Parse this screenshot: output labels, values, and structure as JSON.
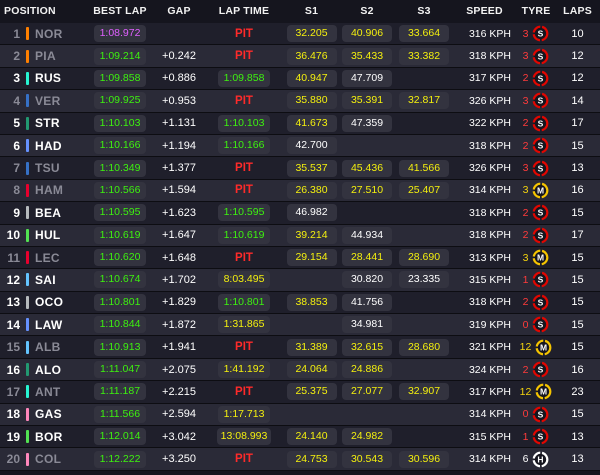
{
  "headers": {
    "position": "POSITION",
    "best_lap": "BEST LAP",
    "gap": "GAP",
    "lap_time": "LAP TIME",
    "s1": "S1",
    "s2": "S2",
    "s3": "S3",
    "speed": "SPEED",
    "tyre": "TYRE",
    "laps": "LAPS"
  },
  "colors": {
    "background": "#15151e",
    "row_even": "#1f1f2b",
    "row_odd": "#2a2a37",
    "green": "#3df20f",
    "purple": "#e060ff",
    "yellow": "#f4f00e",
    "pit_red": "#ff2a2a",
    "soft_tyre": "#e10600",
    "medium_tyre": "#f5c400",
    "hard_tyre": "#ffffff"
  },
  "rows": [
    {
      "pos": "1",
      "code": "NOR",
      "team_color": "#ff8000",
      "dim": true,
      "best_lap": "1:08.972",
      "best_color": "purple",
      "gap": "",
      "lap_time": "PIT",
      "lap_color": "pit",
      "s1": "32.205",
      "s1_color": "yellow",
      "s2": "40.906",
      "s2_color": "yellow",
      "s3": "33.664",
      "s3_color": "yellow",
      "speed": "316 KPH",
      "tyre_age": "3",
      "tyre_age_color": "red",
      "tyre": "S",
      "tyre_name": "soft-tyre-icon",
      "laps": "10"
    },
    {
      "pos": "2",
      "code": "PIA",
      "team_color": "#ff8000",
      "dim": true,
      "best_lap": "1:09.214",
      "best_color": "green",
      "gap": "+0.242",
      "lap_time": "PIT",
      "lap_color": "pit",
      "s1": "36.476",
      "s1_color": "yellow",
      "s2": "35.433",
      "s2_color": "yellow",
      "s3": "33.382",
      "s3_color": "yellow",
      "speed": "318 KPH",
      "tyre_age": "3",
      "tyre_age_color": "red",
      "tyre": "S",
      "tyre_name": "soft-tyre-icon",
      "laps": "12"
    },
    {
      "pos": "3",
      "code": "RUS",
      "team_color": "#27f4d2",
      "dim": false,
      "best_lap": "1:09.858",
      "best_color": "green",
      "gap": "+0.886",
      "lap_time": "1:09.858",
      "lap_color": "green",
      "s1": "40.947",
      "s1_color": "yellow",
      "s2": "47.709",
      "s2_color": "white",
      "s3": "",
      "s3_color": "white",
      "speed": "317 KPH",
      "tyre_age": "2",
      "tyre_age_color": "red",
      "tyre": "S",
      "tyre_name": "soft-tyre-icon",
      "laps": "12"
    },
    {
      "pos": "4",
      "code": "VER",
      "team_color": "#3671c6",
      "dim": true,
      "best_lap": "1:09.925",
      "best_color": "green",
      "gap": "+0.953",
      "lap_time": "PIT",
      "lap_color": "pit",
      "s1": "35.880",
      "s1_color": "yellow",
      "s2": "35.391",
      "s2_color": "yellow",
      "s3": "32.817",
      "s3_color": "yellow",
      "speed": "326 KPH",
      "tyre_age": "3",
      "tyre_age_color": "red",
      "tyre": "S",
      "tyre_name": "soft-tyre-icon",
      "laps": "14"
    },
    {
      "pos": "5",
      "code": "STR",
      "team_color": "#229971",
      "dim": false,
      "best_lap": "1:10.103",
      "best_color": "green",
      "gap": "+1.131",
      "lap_time": "1:10.103",
      "lap_color": "green",
      "s1": "41.673",
      "s1_color": "yellow",
      "s2": "47.359",
      "s2_color": "white",
      "s3": "",
      "s3_color": "white",
      "speed": "322 KPH",
      "tyre_age": "2",
      "tyre_age_color": "red",
      "tyre": "S",
      "tyre_name": "soft-tyre-icon",
      "laps": "17"
    },
    {
      "pos": "6",
      "code": "HAD",
      "team_color": "#6692ff",
      "dim": false,
      "best_lap": "1:10.166",
      "best_color": "green",
      "gap": "+1.194",
      "lap_time": "1:10.166",
      "lap_color": "green",
      "s1": "42.700",
      "s1_color": "white",
      "s2": "",
      "s2_color": "white",
      "s3": "",
      "s3_color": "white",
      "speed": "318 KPH",
      "tyre_age": "2",
      "tyre_age_color": "red",
      "tyre": "S",
      "tyre_name": "soft-tyre-icon",
      "laps": "15"
    },
    {
      "pos": "7",
      "code": "TSU",
      "team_color": "#3671c6",
      "dim": true,
      "best_lap": "1:10.349",
      "best_color": "green",
      "gap": "+1.377",
      "lap_time": "PIT",
      "lap_color": "pit",
      "s1": "35.537",
      "s1_color": "yellow",
      "s2": "45.436",
      "s2_color": "yellow",
      "s3": "41.566",
      "s3_color": "yellow",
      "speed": "326 KPH",
      "tyre_age": "3",
      "tyre_age_color": "red",
      "tyre": "S",
      "tyre_name": "soft-tyre-icon",
      "laps": "13"
    },
    {
      "pos": "8",
      "code": "HAM",
      "team_color": "#e8002d",
      "dim": true,
      "best_lap": "1:10.566",
      "best_color": "green",
      "gap": "+1.594",
      "lap_time": "PIT",
      "lap_color": "pit",
      "s1": "26.380",
      "s1_color": "yellow",
      "s2": "27.510",
      "s2_color": "yellow",
      "s3": "25.407",
      "s3_color": "yellow",
      "speed": "314 KPH",
      "tyre_age": "3",
      "tyre_age_color": "yellow",
      "tyre": "M",
      "tyre_name": "medium-tyre-icon",
      "laps": "16"
    },
    {
      "pos": "9",
      "code": "BEA",
      "team_color": "#b6babd",
      "dim": false,
      "best_lap": "1:10.595",
      "best_color": "green",
      "gap": "+1.623",
      "lap_time": "1:10.595",
      "lap_color": "green",
      "s1": "46.982",
      "s1_color": "white",
      "s2": "",
      "s2_color": "white",
      "s3": "",
      "s3_color": "white",
      "speed": "318 KPH",
      "tyre_age": "2",
      "tyre_age_color": "red",
      "tyre": "S",
      "tyre_name": "soft-tyre-icon",
      "laps": "15"
    },
    {
      "pos": "10",
      "code": "HUL",
      "team_color": "#52e252",
      "dim": false,
      "best_lap": "1:10.619",
      "best_color": "green",
      "gap": "+1.647",
      "lap_time": "1:10.619",
      "lap_color": "green",
      "s1": "39.214",
      "s1_color": "yellow",
      "s2": "44.934",
      "s2_color": "white",
      "s3": "",
      "s3_color": "white",
      "speed": "318 KPH",
      "tyre_age": "2",
      "tyre_age_color": "red",
      "tyre": "S",
      "tyre_name": "soft-tyre-icon",
      "laps": "17"
    },
    {
      "pos": "11",
      "code": "LEC",
      "team_color": "#e8002d",
      "dim": true,
      "best_lap": "1:10.620",
      "best_color": "green",
      "gap": "+1.648",
      "lap_time": "PIT",
      "lap_color": "pit",
      "s1": "29.154",
      "s1_color": "yellow",
      "s2": "28.441",
      "s2_color": "yellow",
      "s3": "28.690",
      "s3_color": "yellow",
      "speed": "313 KPH",
      "tyre_age": "3",
      "tyre_age_color": "yellow",
      "tyre": "M",
      "tyre_name": "medium-tyre-icon",
      "laps": "15"
    },
    {
      "pos": "12",
      "code": "SAI",
      "team_color": "#64c4ff",
      "dim": false,
      "best_lap": "1:10.674",
      "best_color": "green",
      "gap": "+1.702",
      "lap_time": "8:03.495",
      "lap_color": "yellow",
      "s1": "",
      "s1_color": "white",
      "s2": "30.820",
      "s2_color": "white",
      "s3": "23.335",
      "s3_color": "white",
      "speed": "315 KPH",
      "tyre_age": "1",
      "tyre_age_color": "red",
      "tyre": "S",
      "tyre_name": "soft-tyre-icon",
      "laps": "15"
    },
    {
      "pos": "13",
      "code": "OCO",
      "team_color": "#b6babd",
      "dim": false,
      "best_lap": "1:10.801",
      "best_color": "green",
      "gap": "+1.829",
      "lap_time": "1:10.801",
      "lap_color": "green",
      "s1": "38.853",
      "s1_color": "yellow",
      "s2": "41.756",
      "s2_color": "white",
      "s3": "",
      "s3_color": "white",
      "speed": "318 KPH",
      "tyre_age": "2",
      "tyre_age_color": "red",
      "tyre": "S",
      "tyre_name": "soft-tyre-icon",
      "laps": "15"
    },
    {
      "pos": "14",
      "code": "LAW",
      "team_color": "#6692ff",
      "dim": false,
      "best_lap": "1:10.844",
      "best_color": "green",
      "gap": "+1.872",
      "lap_time": "1:31.865",
      "lap_color": "yellow",
      "s1": "",
      "s1_color": "white",
      "s2": "34.981",
      "s2_color": "white",
      "s3": "",
      "s3_color": "white",
      "speed": "319 KPH",
      "tyre_age": "0",
      "tyre_age_color": "red",
      "tyre": "S",
      "tyre_name": "soft-tyre-icon",
      "laps": "15"
    },
    {
      "pos": "15",
      "code": "ALB",
      "team_color": "#64c4ff",
      "dim": true,
      "best_lap": "1:10.913",
      "best_color": "green",
      "gap": "+1.941",
      "lap_time": "PIT",
      "lap_color": "pit",
      "s1": "31.389",
      "s1_color": "yellow",
      "s2": "32.615",
      "s2_color": "yellow",
      "s3": "28.680",
      "s3_color": "yellow",
      "speed": "321 KPH",
      "tyre_age": "12",
      "tyre_age_color": "yellow",
      "tyre": "M",
      "tyre_name": "medium-tyre-icon",
      "laps": "15"
    },
    {
      "pos": "16",
      "code": "ALO",
      "team_color": "#229971",
      "dim": false,
      "best_lap": "1:11.047",
      "best_color": "green",
      "gap": "+2.075",
      "lap_time": "1:41.192",
      "lap_color": "yellow",
      "s1": "24.064",
      "s1_color": "yellow",
      "s2": "24.886",
      "s2_color": "yellow",
      "s3": "",
      "s3_color": "white",
      "speed": "324 KPH",
      "tyre_age": "2",
      "tyre_age_color": "red",
      "tyre": "S",
      "tyre_name": "soft-tyre-icon",
      "laps": "16"
    },
    {
      "pos": "17",
      "code": "ANT",
      "team_color": "#27f4d2",
      "dim": true,
      "best_lap": "1:11.187",
      "best_color": "green",
      "gap": "+2.215",
      "lap_time": "PIT",
      "lap_color": "pit",
      "s1": "25.375",
      "s1_color": "yellow",
      "s2": "27.077",
      "s2_color": "yellow",
      "s3": "32.907",
      "s3_color": "yellow",
      "speed": "317 KPH",
      "tyre_age": "12",
      "tyre_age_color": "yellow",
      "tyre": "M",
      "tyre_name": "medium-tyre-icon",
      "laps": "23"
    },
    {
      "pos": "18",
      "code": "GAS",
      "team_color": "#ff87bc",
      "dim": false,
      "best_lap": "1:11.566",
      "best_color": "green",
      "gap": "+2.594",
      "lap_time": "1:17.713",
      "lap_color": "yellow",
      "s1": "",
      "s1_color": "white",
      "s2": "",
      "s2_color": "white",
      "s3": "",
      "s3_color": "white",
      "speed": "314 KPH",
      "tyre_age": "0",
      "tyre_age_color": "red",
      "tyre": "S",
      "tyre_name": "soft-tyre-icon",
      "laps": "15"
    },
    {
      "pos": "19",
      "code": "BOR",
      "team_color": "#52e252",
      "dim": false,
      "best_lap": "1:12.014",
      "best_color": "green",
      "gap": "+3.042",
      "lap_time": "13:08.993",
      "lap_color": "yellow",
      "s1": "24.140",
      "s1_color": "yellow",
      "s2": "24.982",
      "s2_color": "yellow",
      "s3": "",
      "s3_color": "white",
      "speed": "315 KPH",
      "tyre_age": "1",
      "tyre_age_color": "red",
      "tyre": "S",
      "tyre_name": "soft-tyre-icon",
      "laps": "13"
    },
    {
      "pos": "20",
      "code": "COL",
      "team_color": "#ff87bc",
      "dim": true,
      "best_lap": "1:12.222",
      "best_color": "green",
      "gap": "+3.250",
      "lap_time": "PIT",
      "lap_color": "pit",
      "s1": "24.753",
      "s1_color": "yellow",
      "s2": "30.543",
      "s2_color": "yellow",
      "s3": "30.596",
      "s3_color": "yellow",
      "speed": "314 KPH",
      "tyre_age": "6",
      "tyre_age_color": "white",
      "tyre": "H",
      "tyre_name": "hard-tyre-icon",
      "laps": "13"
    }
  ]
}
